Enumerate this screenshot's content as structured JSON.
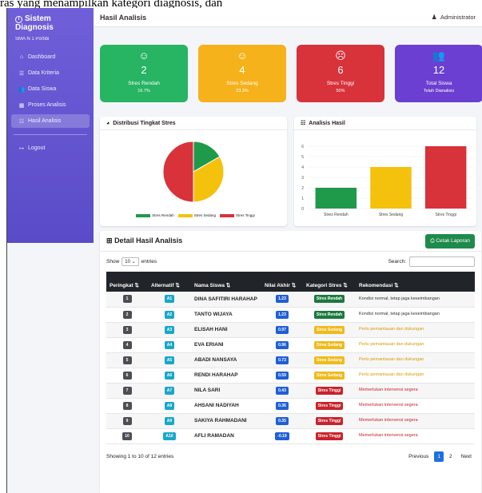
{
  "caption": "ras yang menampilkan kategori diagnosis, dan",
  "app": {
    "brand": "Sistem Diagnosis",
    "school": "SMA N 1 Portibi"
  },
  "sidebar": {
    "items": [
      {
        "label": "Dashboard",
        "icon": "home-icon"
      },
      {
        "label": "Data Kriteria",
        "icon": "list-icon"
      },
      {
        "label": "Data Siswa",
        "icon": "users-icon"
      },
      {
        "label": "Proses Analisis",
        "icon": "calculator-icon"
      },
      {
        "label": "Hasil Analisis",
        "icon": "chart-list-icon"
      }
    ],
    "active": "Hasil Analisis",
    "logout": "Logout"
  },
  "header": {
    "title": "Hasil Analisis",
    "user": "Administrator"
  },
  "cards": [
    {
      "num": "2",
      "label": "Stres Rendah",
      "sub": "16.7%",
      "color": "#27b463",
      "icon": "smile-icon"
    },
    {
      "num": "4",
      "label": "Stres Sedang",
      "sub": "33.3%",
      "color": "#f5b21b",
      "icon": "meh-icon"
    },
    {
      "num": "6",
      "label": "Stres Tinggi",
      "sub": "50%",
      "color": "#d8323b",
      "icon": "frown-icon"
    },
    {
      "num": "12",
      "label": "Total Siswa",
      "sub": "Telah Dianalisis",
      "color": "#6b3fd1",
      "icon": "group-icon"
    }
  ],
  "pie_panel": {
    "title": "Distribusi Tingkat Stres"
  },
  "bar_panel": {
    "title": "Analisis Hasil"
  },
  "chart_data": [
    {
      "type": "pie",
      "categories": [
        "Stres Rendah",
        "Stres Sedang",
        "Stres Tinggi"
      ],
      "values": [
        2,
        4,
        6
      ],
      "colors": [
        "#1f9a4a",
        "#f4c20d",
        "#d8323b"
      ],
      "legend": "bottom"
    },
    {
      "type": "bar",
      "categories": [
        "Stres Rendah",
        "Stres Sedang",
        "Stres Tinggi"
      ],
      "values": [
        2,
        4,
        6
      ],
      "colors": [
        "#1f9a4a",
        "#f4c20d",
        "#d8323b"
      ],
      "ylim": [
        0,
        6
      ],
      "yticks": [
        "0",
        "1",
        "2",
        "3",
        "4",
        "5",
        "6"
      ],
      "grid": true
    }
  ],
  "detail": {
    "title": "Detail Hasil Analisis",
    "print_label": "Cetak Laporan",
    "show": "Show",
    "entries_value": "10",
    "entries": "entries",
    "search": "Search:",
    "columns": [
      "Peringkat",
      "Alternatif",
      "Nama Siswa",
      "Nilai Akhir",
      "Kategori Stres",
      "Rekomendasi"
    ],
    "rows": [
      {
        "rank": "1",
        "alt": "A1",
        "name": "DINA SAFITIRI HARAHAP",
        "score": "1.23",
        "cat": "Stres Rendah",
        "level": "green",
        "rec": "Kondisi normal, tetap jaga keseimbangan"
      },
      {
        "rank": "2",
        "alt": "A2",
        "name": "TANTO WIJAYA",
        "score": "1.23",
        "cat": "Stres Rendah",
        "level": "green",
        "rec": "Kondisi normal, tetap jaga keseimbangan"
      },
      {
        "rank": "3",
        "alt": "A3",
        "name": "ELISAH HANI",
        "score": "0.97",
        "cat": "Stres Sedang",
        "level": "yellow",
        "rec": "Perlu pemantauan dan dukungan"
      },
      {
        "rank": "4",
        "alt": "A4",
        "name": "EVA ERIANI",
        "score": "0.96",
        "cat": "Stres Sedang",
        "level": "yellow",
        "rec": "Perlu pemantauan dan dukungan"
      },
      {
        "rank": "5",
        "alt": "A5",
        "name": "ABADI NANSAYA",
        "score": "0.73",
        "cat": "Stres Sedang",
        "level": "yellow",
        "rec": "Perlu pemantauan dan dukungan"
      },
      {
        "rank": "6",
        "alt": "A6",
        "name": "RENDI HARAHAP",
        "score": "0.59",
        "cat": "Stres Sedang",
        "level": "yellow",
        "rec": "Perlu pemantauan dan dukungan"
      },
      {
        "rank": "7",
        "alt": "A7",
        "name": "NILA SARI",
        "score": "0.43",
        "cat": "Stres Tinggi",
        "level": "red",
        "rec": "Memerlukan intervensi segera"
      },
      {
        "rank": "8",
        "alt": "A8",
        "name": "AHSANI NADIYAH",
        "score": "0.36",
        "cat": "Stres Tinggi",
        "level": "red",
        "rec": "Memerlukan intervensi segera"
      },
      {
        "rank": "9",
        "alt": "A9",
        "name": "SAKIYA RAHMADANI",
        "score": "0.35",
        "cat": "Stres Tinggi",
        "level": "red",
        "rec": "Memerlukan intervensi segera"
      },
      {
        "rank": "10",
        "alt": "A10",
        "name": "AFLI RAMADAN",
        "score": "-0.19",
        "cat": "Stres Tinggi",
        "level": "red",
        "rec": "Memerlukan intervensi segera"
      }
    ],
    "info": "Showing 1 to 10 of 12 entries",
    "pagination": {
      "prev": "Previous",
      "pages": [
        "1",
        "2"
      ],
      "next": "Next"
    }
  },
  "status_colors": {
    "green": "#1c7a3e",
    "yellow": "#f0ba1c",
    "red": "#c8232c"
  }
}
